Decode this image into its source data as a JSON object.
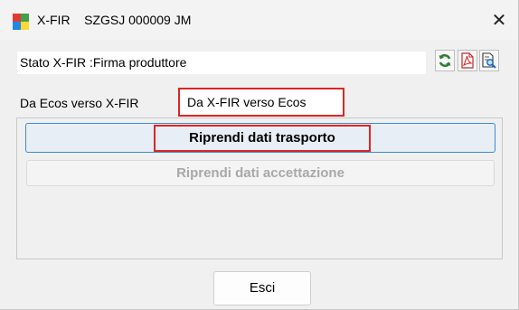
{
  "window": {
    "title": "X-FIR    SZGSJ 000009 JM",
    "close_glyph": "✕"
  },
  "status": {
    "text": "Stato X-FIR :Firma produttore"
  },
  "toolbar": {
    "icons": [
      "refresh-icon",
      "pdf-icon",
      "preview-icon"
    ]
  },
  "tabs": [
    {
      "label": "Da Ecos verso X-FIR",
      "active": false
    },
    {
      "label": "Da X-FIR verso Ecos",
      "active": true
    }
  ],
  "actions": {
    "trasporto_label": "Riprendi dati trasporto",
    "accettazione_label": "Riprendi dati accettazione",
    "esci_label": "Esci"
  },
  "colors": {
    "highlight": "#e02424",
    "focus_border": "#3a8ad8",
    "disabled_text": "#a8a8a8"
  }
}
